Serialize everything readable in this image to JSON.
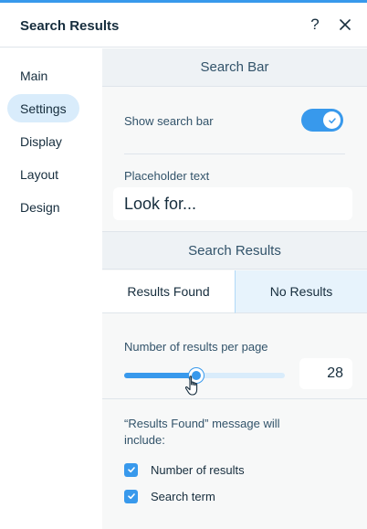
{
  "panel": {
    "title": "Search Results",
    "help_icon": "question-mark-icon",
    "close_icon": "close-icon",
    "accent_color": "#3899ec"
  },
  "sidebar": {
    "items": [
      {
        "label": "Main",
        "active": false
      },
      {
        "label": "Settings",
        "active": true
      },
      {
        "label": "Display",
        "active": false
      },
      {
        "label": "Layout",
        "active": false
      },
      {
        "label": "Design",
        "active": false
      }
    ]
  },
  "search_bar": {
    "section_title": "Search Bar",
    "show_label": "Show search bar",
    "show_enabled": true,
    "placeholder_label": "Placeholder text",
    "placeholder_value": "Look for..."
  },
  "search_results": {
    "section_title": "Search Results",
    "tabs": [
      {
        "label": "Results Found",
        "selected": true
      },
      {
        "label": "No Results",
        "selected": false
      }
    ],
    "per_page_label": "Number of results per page",
    "per_page_value": "28",
    "per_page_fraction": 0.45,
    "message_label": "“Results Found” message will include:",
    "checkboxes": [
      {
        "label": "Number of results",
        "checked": true
      },
      {
        "label": "Search term",
        "checked": true
      }
    ]
  }
}
